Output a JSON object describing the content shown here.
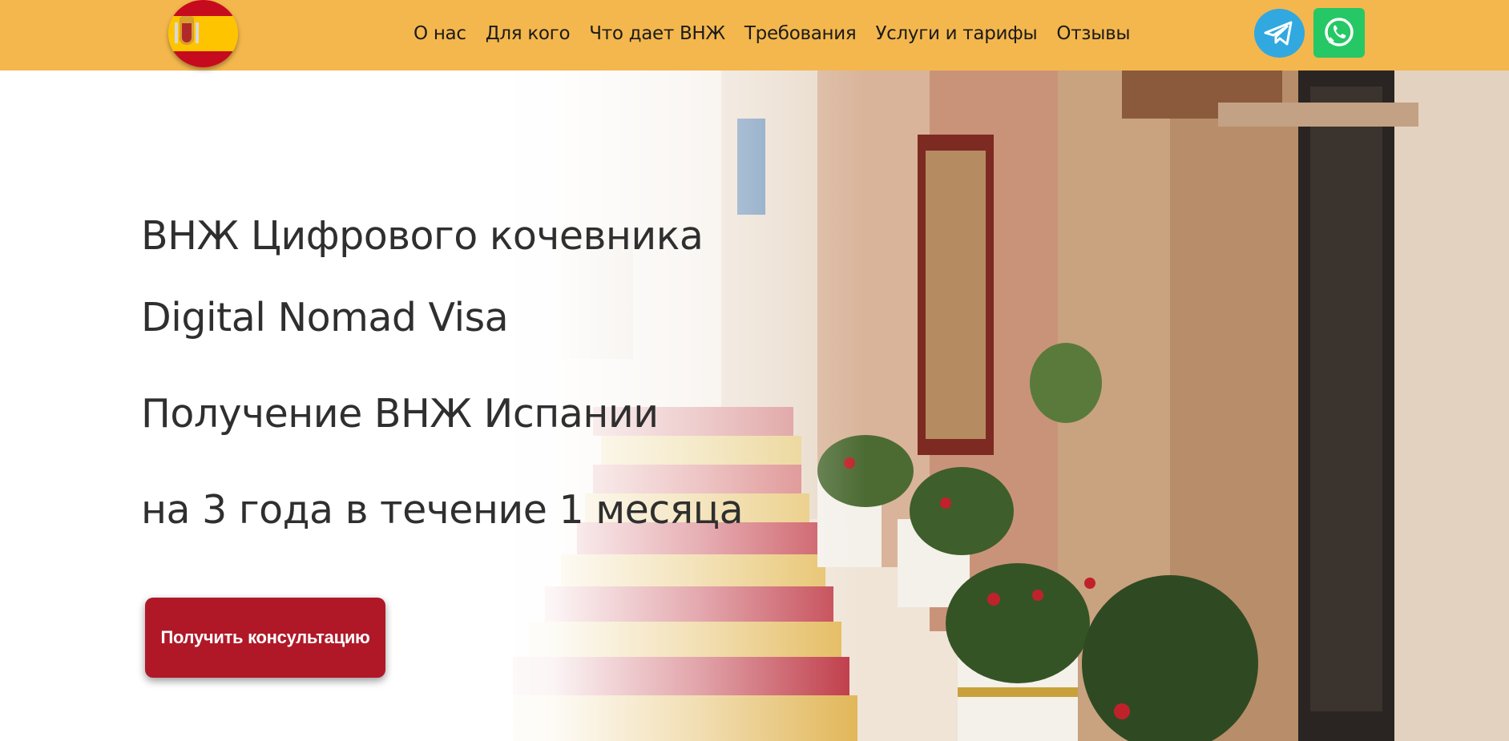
{
  "header": {
    "nav": [
      {
        "label": "О нас"
      },
      {
        "label": "Для кого"
      },
      {
        "label": "Что дает ВНЖ"
      },
      {
        "label": "Требования"
      },
      {
        "label": "Услуги и тарифы"
      },
      {
        "label": "Отзывы"
      }
    ],
    "social": [
      {
        "icon": "telegram-icon",
        "color": "#31a8e0"
      },
      {
        "icon": "whatsapp-icon",
        "color": "#25c865"
      }
    ],
    "background": "#f4b74d"
  },
  "hero": {
    "title_line1": "ВНЖ Цифрового кочевника",
    "title_line2": "Digital Nomad Visa",
    "subtitle_line1": "Получение ВНЖ Испании",
    "subtitle_line2": "на 3 года в течение 1 месяца",
    "cta_label": "Получить консультацию",
    "cta_color": "#b01828"
  }
}
